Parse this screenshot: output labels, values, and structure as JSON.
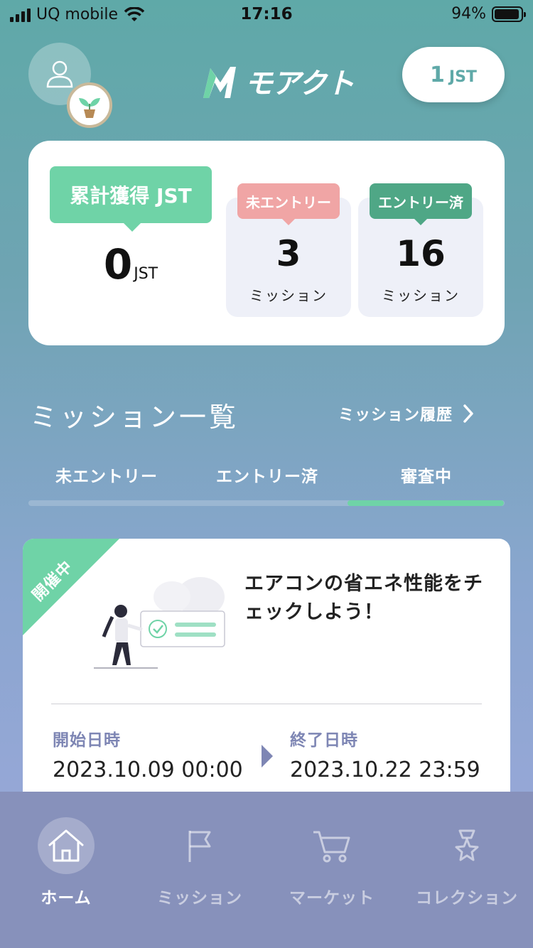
{
  "status_bar": {
    "carrier": "UQ mobile",
    "time": "17:16",
    "battery": "94%",
    "battery_level": 0.94
  },
  "header": {
    "logo_text": "モアクト",
    "jst_balance": "1",
    "jst_unit": "JST"
  },
  "summary": {
    "total_label": "累計獲得 JST",
    "total_value": "0",
    "total_unit": "JST",
    "not_entered": {
      "tag": "未エントリー",
      "count": "3",
      "unit": "ミッション"
    },
    "entered": {
      "tag": "エントリー済",
      "count": "16",
      "unit": "ミッション"
    }
  },
  "mission_list": {
    "title": "ミッション一覧",
    "history_link": "ミッション履歴",
    "tabs": [
      {
        "label": "未エントリー"
      },
      {
        "label": "エントリー済"
      },
      {
        "label": "審査中"
      }
    ],
    "active_tab": 2
  },
  "mission_card": {
    "status": "開催中",
    "title": "エアコンの省エネ性能をチェックしよう！",
    "start_label": "開始日時",
    "start_value": "2023.10.09 00:00",
    "end_label": "終了日時",
    "end_value": "2023.10.22 23:59"
  },
  "bottom_nav": [
    {
      "label": "ホーム",
      "icon": "home-icon",
      "active": true
    },
    {
      "label": "ミッション",
      "icon": "flag-icon",
      "active": false
    },
    {
      "label": "マーケット",
      "icon": "cart-icon",
      "active": false
    },
    {
      "label": "コレクション",
      "icon": "medal-icon",
      "active": false
    }
  ],
  "colors": {
    "accent_green": "#6fd3a7",
    "tag_pink": "#f0a5a5",
    "tag_dark_green": "#4fa786",
    "date_label": "#7e86b4",
    "nav_bg": "#8791bb"
  }
}
